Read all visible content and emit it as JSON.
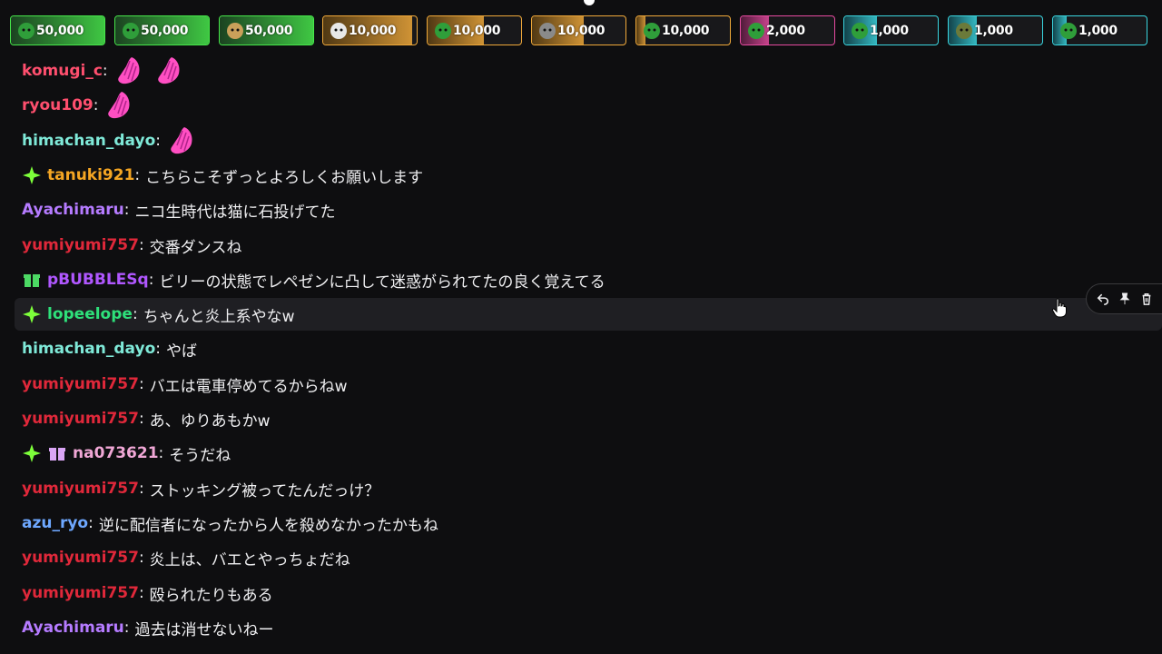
{
  "hype_chips": [
    {
      "amount": "50,000",
      "accent": "#46e64a",
      "tint": "#1c4a22",
      "fill_pct": 1.0,
      "avatar_color": "#2f9e3a",
      "avatar_icon": "green-character-icon"
    },
    {
      "amount": "50,000",
      "accent": "#46e64a",
      "tint": "#1c4a22",
      "fill_pct": 1.0,
      "avatar_color": "#2f9e3a",
      "avatar_icon": "green-character-icon"
    },
    {
      "amount": "50,000",
      "accent": "#46e64a",
      "tint": "#1c4a22",
      "fill_pct": 1.0,
      "avatar_color": "#c9a05a",
      "avatar_icon": "shiba-character-icon"
    },
    {
      "amount": "10,000",
      "accent": "#f0a93a",
      "tint": "#5a3e12",
      "fill_pct": 0.95,
      "avatar_color": "#e8e8e8",
      "avatar_icon": "white-character-icon"
    },
    {
      "amount": "10,000",
      "accent": "#f0a93a",
      "tint": "#5a3e12",
      "fill_pct": 0.6,
      "avatar_color": "#2f9e3a",
      "avatar_icon": "green-character-icon"
    },
    {
      "amount": "10,000",
      "accent": "#f0a93a",
      "tint": "#5a3e12",
      "fill_pct": 0.55,
      "avatar_color": "#8a8a8a",
      "avatar_icon": "gray-character-icon"
    },
    {
      "amount": "10,000",
      "accent": "#f0a93a",
      "tint": "#5a3e12",
      "fill_pct": 0.1,
      "avatar_color": "#2f9e3a",
      "avatar_icon": "green-character-icon"
    },
    {
      "amount": "2,000",
      "accent": "#e64aa0",
      "tint": "#5a1c40",
      "fill_pct": 0.3,
      "avatar_color": "#2f9e3a",
      "avatar_icon": "green-character-icon"
    },
    {
      "amount": "1,000",
      "accent": "#3ad6e0",
      "tint": "#124a52",
      "fill_pct": 0.35,
      "avatar_color": "#2f9e3a",
      "avatar_icon": "green-character-icon"
    },
    {
      "amount": "1,000",
      "accent": "#3ad6e0",
      "tint": "#124a52",
      "fill_pct": 0.3,
      "avatar_color": "#6b7a3a",
      "avatar_icon": "olive-character-icon"
    },
    {
      "amount": "1,000",
      "accent": "#3ad6e0",
      "tint": "#124a52",
      "fill_pct": 0.15,
      "avatar_color": "#2f9e3a",
      "avatar_icon": "green-character-icon"
    }
  ],
  "messages": [
    {
      "user": "komugi_c",
      "color": "#ff4f6e",
      "badges": [],
      "text": "",
      "emotes": 2
    },
    {
      "user": "ryou109",
      "color": "#ff4f6e",
      "badges": [],
      "text": "",
      "emotes": 1
    },
    {
      "user": "himachan_dayo",
      "color": "#7fe9d8",
      "badges": [],
      "text": "",
      "emotes": 1
    },
    {
      "user": "tanuki921",
      "color": "#f5a623",
      "badges": [
        "sparkle-badge"
      ],
      "text": "こちらこそずっとよろしくお願いします",
      "emotes": 0
    },
    {
      "user": "Ayachimaru",
      "color": "#b57bff",
      "badges": [],
      "text": "ニコ生時代は猫に石投げてた",
      "emotes": 0
    },
    {
      "user": "yumiyumi757",
      "color": "#e0283a",
      "badges": [],
      "text": "交番ダンスね",
      "emotes": 0
    },
    {
      "user": "pBUBBLESq",
      "color": "#b057ff",
      "badges": [
        "gift-badge-green"
      ],
      "text": "ビリーの状態でレペゼンに凸して迷惑がられてたの良く覚えてる",
      "emotes": 0
    },
    {
      "user": "lopeelope",
      "color": "#2ee07a",
      "badges": [
        "sparkle-badge"
      ],
      "text": "ちゃんと炎上系やなw",
      "emotes": 0,
      "hover": true
    },
    {
      "user": "himachan_dayo",
      "color": "#7fe9d8",
      "badges": [],
      "text": "やば",
      "emotes": 0
    },
    {
      "user": "yumiyumi757",
      "color": "#e0283a",
      "badges": [],
      "text": "バエは電車停めてるからねw",
      "emotes": 0
    },
    {
      "user": "yumiyumi757",
      "color": "#e0283a",
      "badges": [],
      "text": "あ、ゆりあもかw",
      "emotes": 0
    },
    {
      "user": "na073621",
      "color": "#f0a7d6",
      "badges": [
        "sparkle-badge",
        "gift-badge-purple"
      ],
      "text": "そうだね",
      "emotes": 0
    },
    {
      "user": "yumiyumi757",
      "color": "#e0283a",
      "badges": [],
      "text": "ストッキング被ってたんだっけ？",
      "emotes": 0
    },
    {
      "user": "azu_ryo",
      "color": "#6ea8ff",
      "badges": [],
      "text": "逆に配信者になったから人を殺めなかったかもね",
      "emotes": 0
    },
    {
      "user": "yumiyumi757",
      "color": "#e0283a",
      "badges": [],
      "text": "炎上は、バエとやっちょだね",
      "emotes": 0
    },
    {
      "user": "yumiyumi757",
      "color": "#e0283a",
      "badges": [],
      "text": "殴られたりもある",
      "emotes": 0
    },
    {
      "user": "Ayachimaru",
      "color": "#b57bff",
      "badges": [],
      "text": "過去は消せないねー",
      "emotes": 0
    }
  ],
  "colon": ":",
  "mod_tools": [
    "reply-icon",
    "pin-icon",
    "delete-icon"
  ],
  "emote_icon": "pink-praying-hands-emote"
}
